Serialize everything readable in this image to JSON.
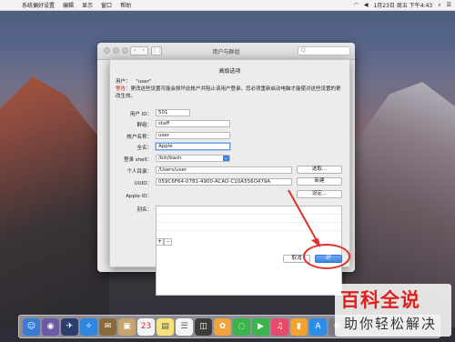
{
  "menubar": {
    "items": [
      "系统偏好设置",
      "编辑",
      "显示",
      "窗口",
      "帮助"
    ],
    "clock": "1月23日 周五 下午4:43"
  },
  "window": {
    "title": "用户与群组",
    "search_placeholder": "Q"
  },
  "sheet": {
    "title": "高级选项",
    "user_label": "用户：",
    "user_value": "\"user\"",
    "warning_label": "警告：",
    "warning_text": "更改这些设置可能会损坏此帐户并阻止该用户登录。您必须重新启动电脑才能使对这些设置的更改生效。",
    "fields": {
      "user_id": {
        "label": "用户 ID：",
        "value": "501"
      },
      "group": {
        "label": "群组：",
        "value": "staff"
      },
      "account_name": {
        "label": "帐户名称：",
        "value": "user"
      },
      "full_name": {
        "label": "全名：",
        "value": "Apple"
      },
      "login_shell": {
        "label": "登录 shell：",
        "value": "/bin/bash"
      },
      "home_dir": {
        "label": "个人目录：",
        "value": "/Users/user",
        "button": "选取..."
      },
      "uuid": {
        "label": "UUID：",
        "value": "059C6F64-0781-4900-ACAO-C10A556O479A",
        "button": "新建"
      },
      "apple_id": {
        "label": "Apple ID：",
        "button": "设定..."
      },
      "aliases": {
        "label": "别名："
      }
    },
    "plus": "+",
    "minus": "–",
    "cancel": "取消",
    "ok": "好"
  },
  "watermark": {
    "line1": "百科全说",
    "line2": "助你轻松解决"
  }
}
